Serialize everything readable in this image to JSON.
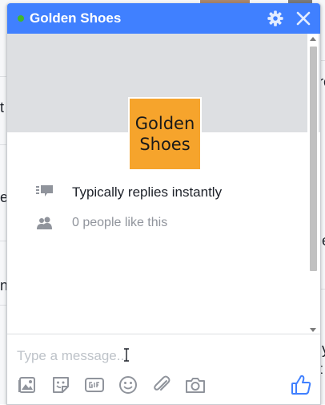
{
  "background_page": {
    "fragments": [
      "t",
      "e",
      "ne",
      "ro",
      "ie",
      "ly",
      "t"
    ]
  },
  "chat": {
    "title": "Golden Shoes",
    "online": true,
    "header_color": "#4080ff",
    "logo": {
      "line1": "Golden",
      "line2": "Shoes",
      "color": "#f6a42c"
    },
    "info": {
      "replies_text": "Typically replies instantly",
      "likes_text": "0 people like this"
    },
    "composer": {
      "placeholder": "Type a message...",
      "value": ""
    },
    "toolbar": {
      "icons": [
        "photo-icon",
        "sticker-icon",
        "gif-icon",
        "emoji-icon",
        "attachment-icon",
        "camera-icon"
      ],
      "send_icon": "thumbs-up-icon"
    }
  }
}
